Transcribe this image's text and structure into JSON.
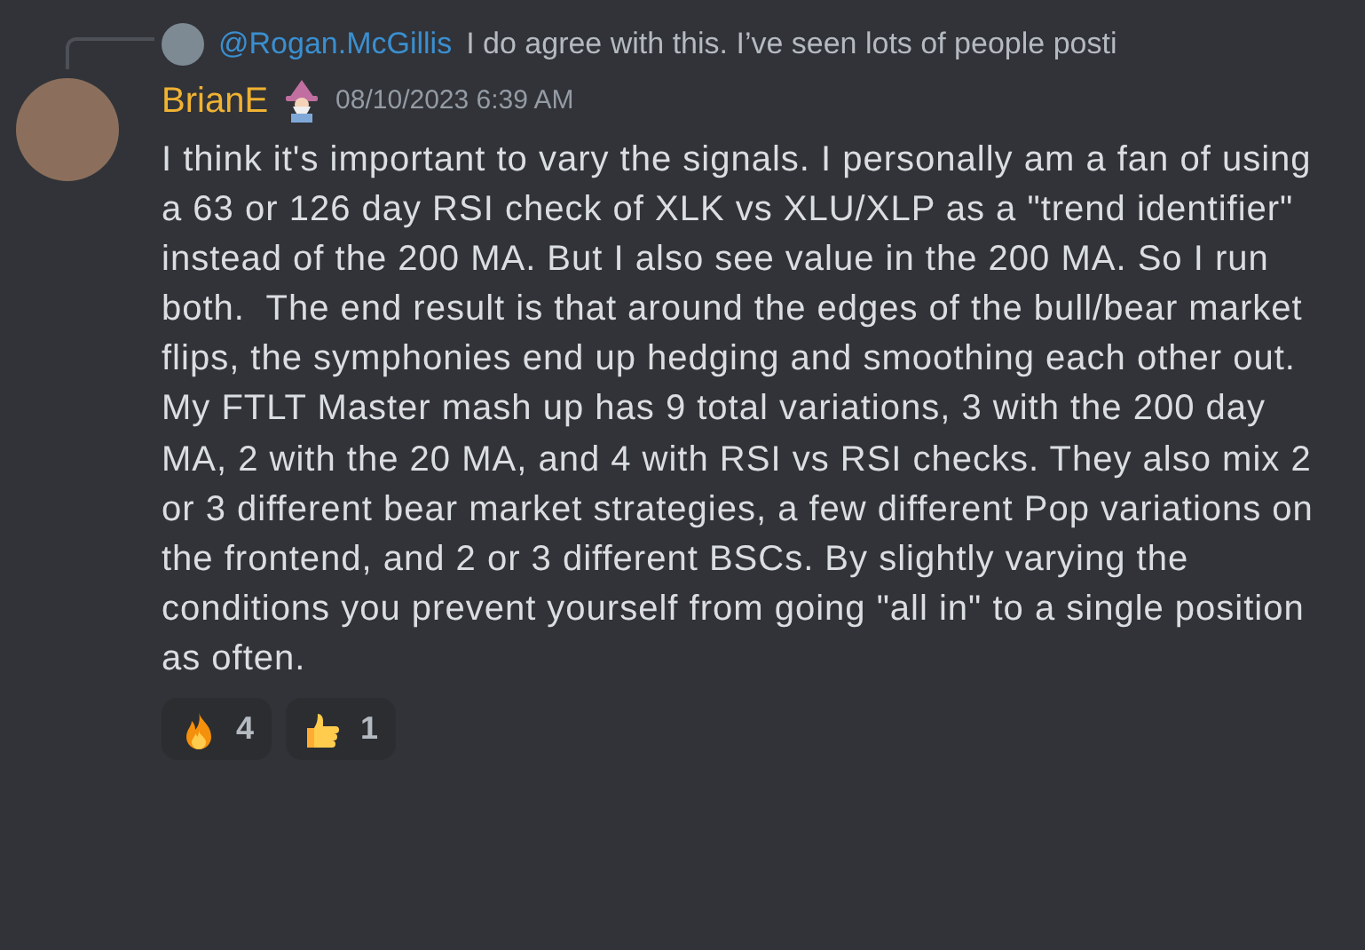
{
  "reply": {
    "author": "@Rogan.McGillis",
    "snippet": "I do agree with this. I’ve seen lots of people posti"
  },
  "message": {
    "author": "BrianE",
    "timestamp": "08/10/2023 6:39 AM",
    "text": "I think it's important to vary the signals. I personally am a fan of using a 63 or 126 day RSI check of XLK vs XLU/XLP as a \"trend identifier\" instead of the 200 MA. But I also see value in the 200 MA. So I run both.  The end result is that around the edges of the bull/bear market flips, the symphonies end up hedging and smoothing each other out. My FTLT Master mash up has 9 total variations, 3 with the 200 day MA, 2 with the 20 MA, and 4 with RSI vs RSI checks. They also mix 2 or 3 different bear market strategies, a few different Pop variations on the frontend, and 2 or 3 different BSCs. By slightly varying the conditions you prevent yourself from going \"all in\" to a single position as often."
  },
  "reactions": [
    {
      "kind": "fire",
      "count": "4"
    },
    {
      "kind": "thumbs-up",
      "count": "1"
    }
  ]
}
